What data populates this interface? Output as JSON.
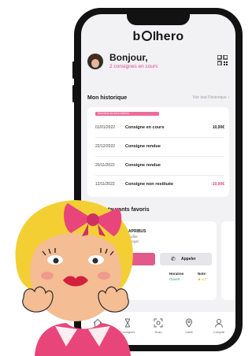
{
  "app": {
    "logo_left": "b",
    "logo_right": "hero"
  },
  "greeting": {
    "title": "Bonjour,",
    "subtitle": "2 consignes en cours"
  },
  "history": {
    "heading": "Mon historique",
    "see_all": "Voir tout l'historique",
    "tag": "Souviens-toi avec bolhero",
    "rows": [
      {
        "date": "01/01/2022",
        "label": "Consigne en cours",
        "amount": "10,00€",
        "negative": false
      },
      {
        "date": "22/12/2022",
        "label": "Consigne rendue",
        "amount": "",
        "negative": false
      },
      {
        "date": "20/11/2022",
        "label": "Consigne rendue",
        "amount": "",
        "negative": false
      },
      {
        "date": "12/11/2022",
        "label": "Consigne non restituée",
        "amount": "-10,00€",
        "negative": true
      }
    ]
  },
  "favorites": {
    "heading": "Mes restaurants favoris",
    "restaurant": {
      "name": "APRIBUS",
      "line1": "Buffet",
      "line2": "Burger"
    },
    "call_label": "Appeler",
    "info": [
      {
        "key": "Horaires",
        "value": "Ouvert",
        "color": "#2aa35a"
      },
      {
        "key": "Note",
        "value": "★ 4.7",
        "color": "#e0a400"
      }
    ]
  },
  "tabs": [
    {
      "label": "Accueil",
      "icon": "home-icon"
    },
    {
      "label": "Consignes",
      "icon": "hourglass-icon"
    },
    {
      "label": "Scan",
      "icon": "scan-icon"
    },
    {
      "label": "Carte",
      "icon": "map-pin-icon"
    },
    {
      "label": "Compte",
      "icon": "user-icon"
    }
  ],
  "colors": {
    "accent": "#e25a8c",
    "phone": "#121212",
    "background": "#f2f2f4"
  }
}
